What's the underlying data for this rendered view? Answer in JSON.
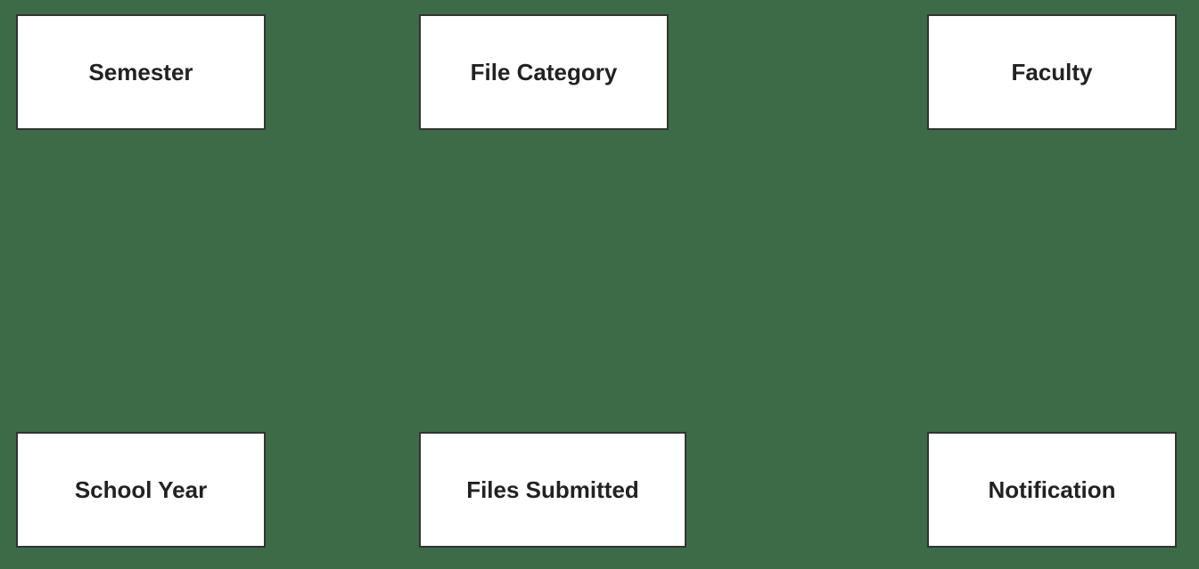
{
  "entities": {
    "semester": "Semester",
    "file_category": "File Category",
    "faculty": "Faculty",
    "school_year": "School Year",
    "files_submitted": "Files Submitted",
    "notification": "Notification"
  }
}
